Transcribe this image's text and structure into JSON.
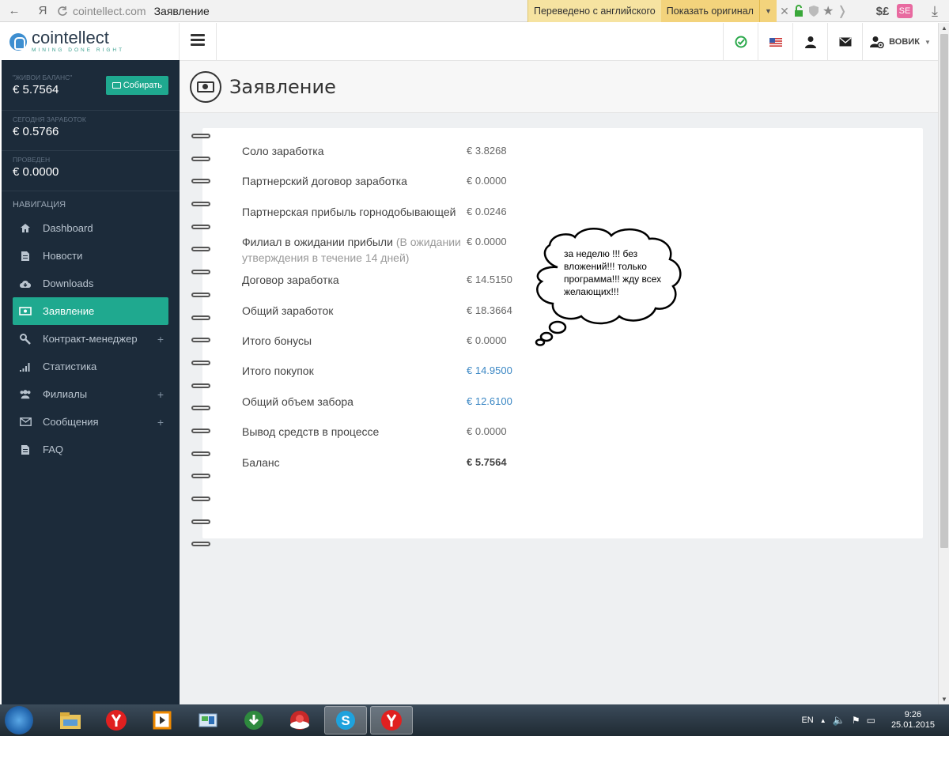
{
  "browser": {
    "back": "←",
    "yandex_letter": "Я",
    "domain": "cointellect.com",
    "tab_title": "Заявление",
    "translated_label": "Переведено с английского",
    "show_original_label": "Показать оригинал",
    "extension_label": "$£"
  },
  "sidebar": {
    "brand": "cointellect",
    "tagline": "MINING DONE RIGHT",
    "live_balance": {
      "caption": "\"ЖИВОИ БАЛАНС\"",
      "value": "€ 5.7564"
    },
    "collect_button": "Собирать",
    "today_earnings": {
      "caption": "СЕГОДНЯ ЗАРАБОТОК",
      "value": "€ 0.5766"
    },
    "settled": {
      "caption": "ПРОВЕДЕН",
      "value": "€ 0.0000"
    },
    "nav_header": "НАВИГАЦИЯ",
    "items": [
      {
        "label": "Dashboard",
        "icon": "home-icon"
      },
      {
        "label": "Новости",
        "icon": "document-icon"
      },
      {
        "label": "Downloads",
        "icon": "cloud-download-icon"
      },
      {
        "label": "Заявление",
        "icon": "money-icon",
        "active": true
      },
      {
        "label": "Контракт-менеджер",
        "icon": "wrench-icon",
        "plus": "+"
      },
      {
        "label": "Статистика",
        "icon": "signal-bars-icon"
      },
      {
        "label": "Филиалы",
        "icon": "users-icon",
        "plus": "+"
      },
      {
        "label": "Сообщения",
        "icon": "envelope-icon",
        "plus": "+"
      },
      {
        "label": "FAQ",
        "icon": "document-icon"
      }
    ]
  },
  "header": {
    "user_name": "ВОВИК"
  },
  "page": {
    "title": "Заявление",
    "rows": [
      {
        "label": "Соло заработка",
        "note": "",
        "value": "€ 3.8268",
        "style": "plain"
      },
      {
        "label": "Партнерский договор заработка",
        "note": "",
        "value": "€ 0.0000",
        "style": "plain"
      },
      {
        "label": "Партнерская прибыль горнодобывающей",
        "note": "",
        "value": "€ 0.0246",
        "style": "plain"
      },
      {
        "label": "Филиал в ожидании прибыли",
        "note": "(В ожидании утверждения в течение 14 дней)",
        "value": "€ 0.0000",
        "style": "plain"
      },
      {
        "label": "Договор заработка",
        "note": "",
        "value": "€ 14.5150",
        "style": "plain"
      },
      {
        "label": "Общий заработок",
        "note": "",
        "value": "€ 18.3664",
        "style": "plain"
      },
      {
        "label": "Итого бонусы",
        "note": "",
        "value": "€ 0.0000",
        "style": "plain"
      },
      {
        "label": "Итого покупок",
        "note": "",
        "value": "€ 14.9500",
        "style": "link"
      },
      {
        "label": "Общий объем забора",
        "note": "",
        "value": "€ 12.6100",
        "style": "link"
      },
      {
        "label": "Вывод средств в процессе",
        "note": "",
        "value": "€ 0.0000",
        "style": "plain"
      },
      {
        "label": "Баланс",
        "note": "",
        "value": "€ 5.7564",
        "style": "bold"
      }
    ],
    "bubble_text": "за неделю !!! без вложений!!! только программа!!! жду всех желающих!!!"
  },
  "taskbar": {
    "lang": "EN",
    "time": "9:26",
    "date": "25.01.2015"
  },
  "colors": {
    "sidebar_bg": "#1c2b3a",
    "accent": "#1fa98f",
    "link": "#3b87c4"
  }
}
